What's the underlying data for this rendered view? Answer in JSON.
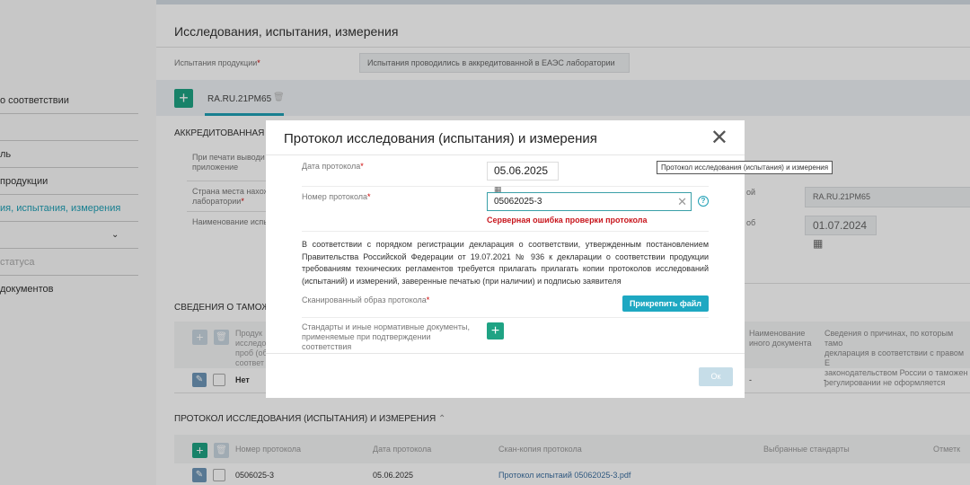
{
  "sidebar": {
    "items": [
      "о соответствии",
      "ль",
      "продукции",
      "ия, испытания, измерения",
      "",
      "статуса",
      "документов"
    ]
  },
  "main": {
    "title": "Исследования, испытания, измерения",
    "product_tests_label": "Испытания продукции",
    "product_tests_value": "Испытания проводились в аккредитованной в ЕАЭС лаборатории",
    "tab_label": "RA.RU.21PM65",
    "accredited_section": "АККРЕДИТОВАННАЯ И",
    "print_label": "При печати выводи",
    "print_label2": "приложение",
    "country_label": "Страна места нахож",
    "country_label2": "лаборатории",
    "name_label": "Наименование испы",
    "reg_label_tail": "ой",
    "reg_value": "RA.RU.21PM65",
    "date_label_tail": "об",
    "date_value": "01.07.2024",
    "customs_section": "СВЕДЕНИЯ О ТАМОЖЕ",
    "customs_headers": [
      "Продук",
      "исследо",
      "проб (об",
      "соответ"
    ],
    "customs_headers_right": [
      "Наименование",
      "иного документа"
    ],
    "customs_headers_far": [
      "Сведения о причинах, по которым тамо",
      "декларация в соответствии с правом Е",
      "законодательством России о таможен",
      "регулировании не оформляется"
    ],
    "customs_row": {
      "value": "Нет",
      "c2": "-",
      "c3": "-"
    },
    "protocol_section": "ПРОТОКОЛ ИССЛЕДОВАНИЯ (ИСПЫТАНИЯ) И ИЗМЕРЕНИЯ",
    "protocol_headers": [
      "Номер протокола",
      "Дата протокола",
      "Скан-копия протокола",
      "Выбранные стандарты",
      "Отметк"
    ],
    "protocol_row": {
      "number": "0506025-3",
      "date": "05.06.2025",
      "file": "Протокол испытаий 05062025-3.pdf"
    }
  },
  "modal": {
    "title": "Протокол исследования (испытания) и измерения",
    "date_label": "Дата протокола",
    "date_value": "05.06.2025",
    "number_label": "Номер протокола",
    "number_value": "05062025-3",
    "error": "Серверная ошибка проверки протокола",
    "paragraph": "В соответствии с порядком регистрации декларация о соответствии, утвержденным постановлением Правительства Российской Федерации от 19.07.2021 № 936 к декларации о соответствии продукции требованиям технических регламентов требуется прилагать прилагать копии протоколов исследований (испытаний) и измерений, заверенные печатью (при наличии) и подписью заявителя",
    "scan_label": "Сканированный образ протокола",
    "attach_button": "Прикрепить файл",
    "standards_label": "Стандарты и иные нормативные документы, применяемые при подтверждении соответствия",
    "ok_button": "Ок",
    "required_mark": "*"
  },
  "tooltip": "Протокол исследования (испытания) и измерения"
}
